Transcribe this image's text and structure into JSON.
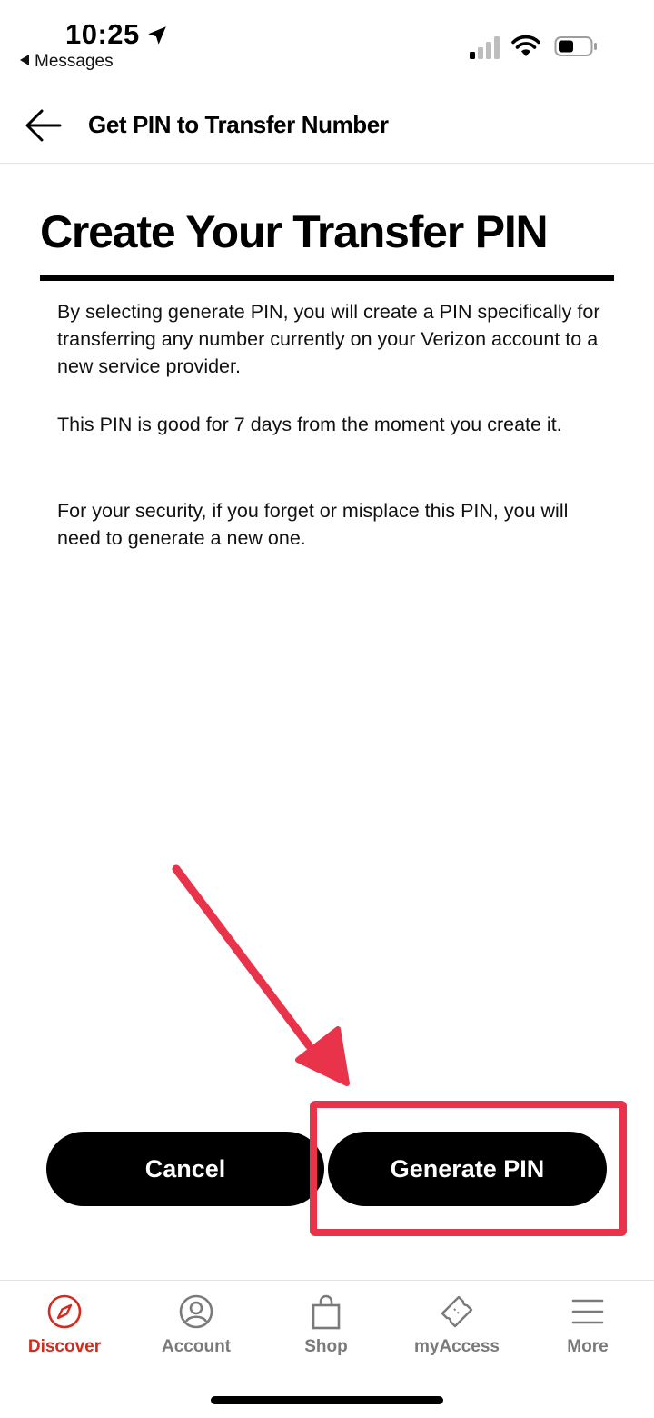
{
  "status_bar": {
    "time": "10:25",
    "back_app": "Messages"
  },
  "header": {
    "title": "Get PIN to Transfer Number"
  },
  "main": {
    "title": "Create Your Transfer PIN",
    "paragraphs": [
      "By selecting generate PIN, you will create a PIN specifically for transferring any number currently on your Verizon account to a new service provider.",
      "This PIN is good for 7 days from the moment you create it.",
      "For your security, if you forget or misplace this PIN, you will need to generate a new one."
    ]
  },
  "buttons": {
    "cancel": "Cancel",
    "generate": "Generate PIN"
  },
  "bottom_nav": {
    "items": [
      {
        "label": "Discover",
        "icon": "compass-icon",
        "active": true
      },
      {
        "label": "Account",
        "icon": "person-icon",
        "active": false
      },
      {
        "label": "Shop",
        "icon": "shopping-bag-icon",
        "active": false
      },
      {
        "label": "myAccess",
        "icon": "ticket-icon",
        "active": false
      },
      {
        "label": "More",
        "icon": "menu-icon",
        "active": false
      }
    ]
  },
  "colors": {
    "accent_red": "#d52b1e",
    "annotation_red": "#e8334a",
    "nav_inactive": "#7a7a7a"
  }
}
